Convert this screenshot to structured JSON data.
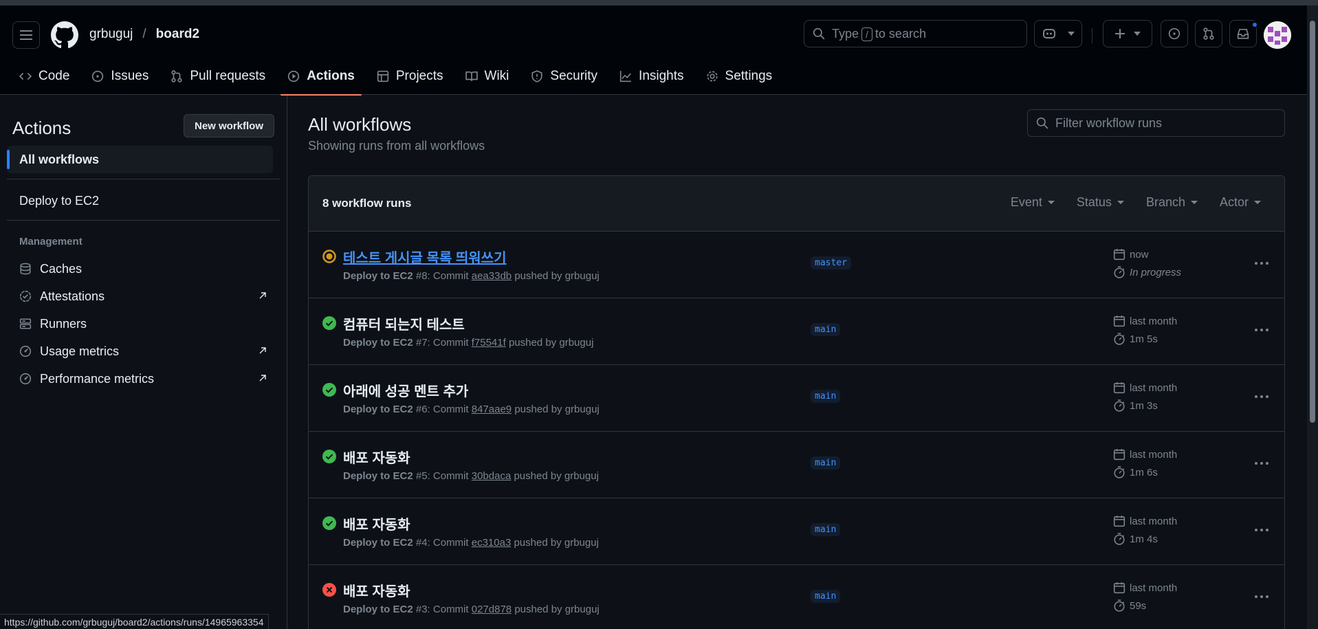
{
  "header": {
    "owner": "grbuguj",
    "separator": "/",
    "repo": "board2",
    "search": {
      "before": "Type",
      "key": "/",
      "after": "to search"
    }
  },
  "tabs": [
    {
      "label": "Code",
      "icon": "code-icon"
    },
    {
      "label": "Issues",
      "icon": "issue-icon"
    },
    {
      "label": "Pull requests",
      "icon": "pull-request-icon"
    },
    {
      "label": "Actions",
      "icon": "play-icon",
      "active": true
    },
    {
      "label": "Projects",
      "icon": "table-icon"
    },
    {
      "label": "Wiki",
      "icon": "book-icon"
    },
    {
      "label": "Security",
      "icon": "shield-icon"
    },
    {
      "label": "Insights",
      "icon": "graph-icon"
    },
    {
      "label": "Settings",
      "icon": "gear-icon"
    }
  ],
  "sidebar": {
    "title": "Actions",
    "new_workflow": "New workflow",
    "all_workflows": "All workflows",
    "workflows": [
      "Deploy to EC2"
    ],
    "management_heading": "Management",
    "management": [
      {
        "label": "Caches",
        "icon": "database-icon",
        "external": false
      },
      {
        "label": "Attestations",
        "icon": "verified-icon",
        "external": true
      },
      {
        "label": "Runners",
        "icon": "server-icon",
        "external": false
      },
      {
        "label": "Usage metrics",
        "icon": "meter-icon",
        "external": true
      },
      {
        "label": "Performance metrics",
        "icon": "meter-icon",
        "external": true
      }
    ]
  },
  "main": {
    "title": "All workflows",
    "subtitle": "Showing runs from all workflows",
    "filter_placeholder": "Filter workflow runs",
    "count": "8 workflow runs",
    "filters": [
      "Event",
      "Status",
      "Branch",
      "Actor"
    ],
    "runs": [
      {
        "status": "in-progress",
        "title": "테스트 게시글 목록 띄워쓰기",
        "workflow": "Deploy to EC2",
        "num": "#8",
        "commit": "aea33db",
        "by": "grbuguj",
        "branch": "master",
        "when": "now",
        "duration": "In progress"
      },
      {
        "status": "success",
        "title": "컴퓨터 되는지 테스트",
        "workflow": "Deploy to EC2",
        "num": "#7",
        "commit": "f75541f",
        "by": "grbuguj",
        "branch": "main",
        "when": "last month",
        "duration": "1m 5s"
      },
      {
        "status": "success",
        "title": "아래에 성공 멘트 추가",
        "workflow": "Deploy to EC2",
        "num": "#6",
        "commit": "847aae9",
        "by": "grbuguj",
        "branch": "main",
        "when": "last month",
        "duration": "1m 3s"
      },
      {
        "status": "success",
        "title": "배포 자동화",
        "workflow": "Deploy to EC2",
        "num": "#5",
        "commit": "30bdaca",
        "by": "grbuguj",
        "branch": "main",
        "when": "last month",
        "duration": "1m 6s"
      },
      {
        "status": "success",
        "title": "배포 자동화",
        "workflow": "Deploy to EC2",
        "num": "#4",
        "commit": "ec310a3",
        "by": "grbuguj",
        "branch": "main",
        "when": "last month",
        "duration": "1m 4s"
      },
      {
        "status": "failure",
        "title": "배포 자동화",
        "workflow": "Deploy to EC2",
        "num": "#3",
        "commit": "027d878",
        "by": "grbuguj",
        "branch": "main",
        "when": "last month",
        "duration": "59s"
      }
    ],
    "meta_commit": "Commit",
    "meta_pushed": "pushed by"
  },
  "statusbar": "https://github.com/grbuguj/board2/actions/runs/14965963354",
  "colors": {
    "accent": "#f78166",
    "link": "#4493f8",
    "success": "#3fb950",
    "failure": "#f85149",
    "progress": "#d29922"
  }
}
